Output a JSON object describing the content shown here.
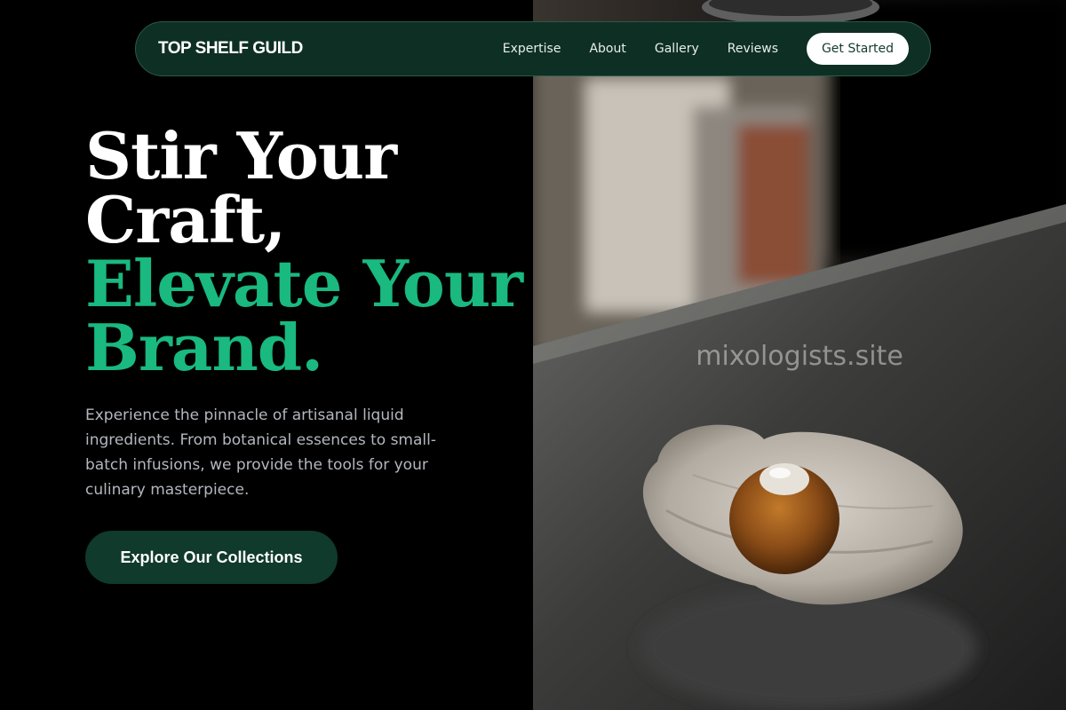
{
  "nav": {
    "brand": "TOP SHELF GUILD",
    "links": [
      "Expertise",
      "About",
      "Gallery",
      "Reviews"
    ],
    "cta_label": "Get Started"
  },
  "hero": {
    "headline_line1": "Stir Your",
    "headline_line2": "Craft,",
    "headline_line3": "Elevate Your",
    "headline_line4": "Brand.",
    "description": "Experience the pinnacle of artisanal liquid ingredients. From botanical essences to small-batch infusions, we provide the tools for your culinary masterpiece.",
    "cta_label": "Explore Our Collections"
  },
  "photo": {
    "watermark": "mixologists.site"
  },
  "colors": {
    "accent_green": "#19b980",
    "nav_bg": "#0e2f24",
    "cta_bg": "#0f3a2c"
  }
}
